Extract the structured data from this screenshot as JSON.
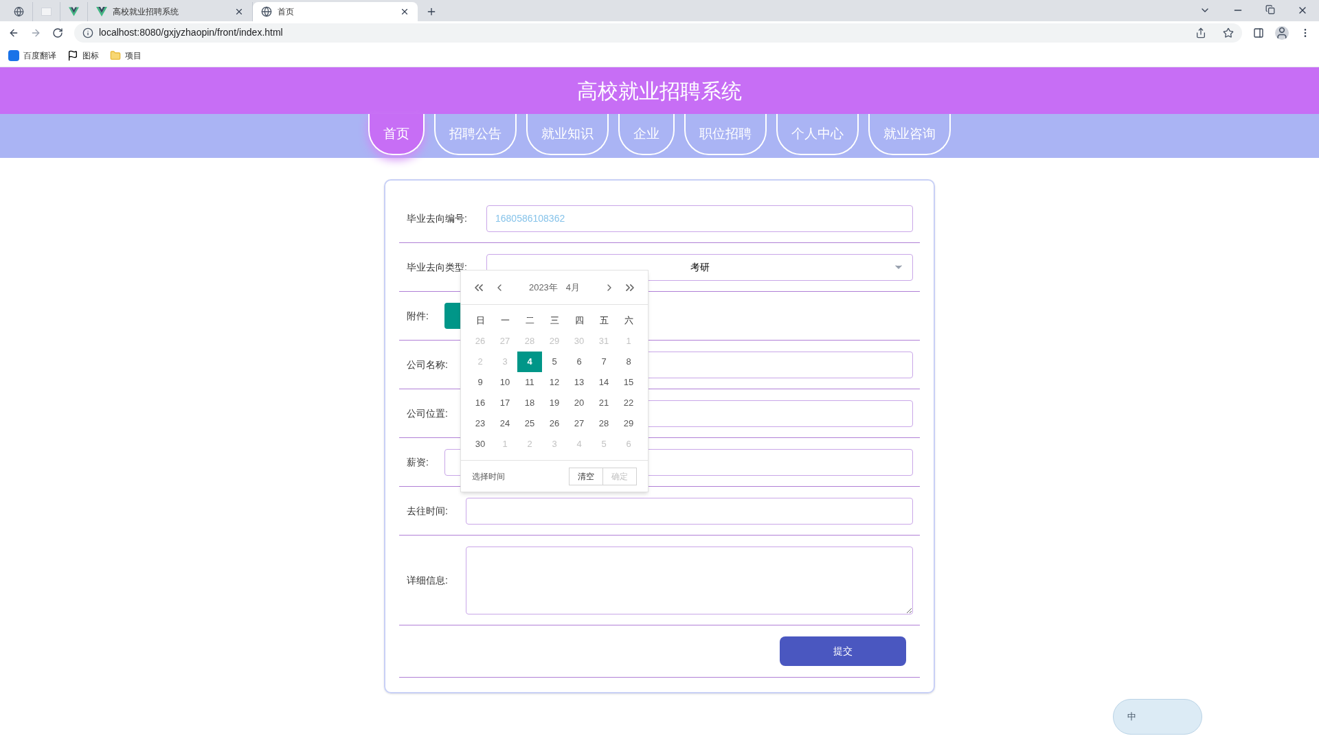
{
  "browser": {
    "tabs": [
      {
        "selected": false
      },
      {
        "selected": false
      },
      {
        "selected": false
      },
      {
        "title": "高校就业招聘系统",
        "selected": false
      },
      {
        "title": "首页",
        "selected": true
      }
    ],
    "url": "localhost:8080/gxjyzhaopin/front/index.html",
    "bookmarks": [
      {
        "label": "百度翻译"
      },
      {
        "label": "图标"
      },
      {
        "label": "项目"
      }
    ]
  },
  "header": {
    "title": "高校就业招聘系统"
  },
  "nav": [
    {
      "label": "首页",
      "selected": true
    },
    {
      "label": "招聘公告",
      "selected": false
    },
    {
      "label": "就业知识",
      "selected": false
    },
    {
      "label": "企业",
      "selected": false
    },
    {
      "label": "职位招聘",
      "selected": false
    },
    {
      "label": "个人中心",
      "selected": false
    },
    {
      "label": "就业咨询",
      "selected": false
    }
  ],
  "form": {
    "rows": [
      {
        "kind": "input",
        "label": "毕业去向编号:",
        "value": "1680586108362",
        "readonly": true
      },
      {
        "kind": "select",
        "label": "毕业去向类型:",
        "value": "考研"
      },
      {
        "kind": "upload",
        "label": "附件:"
      },
      {
        "kind": "input",
        "label": "公司名称:",
        "value": ""
      },
      {
        "kind": "input",
        "label": "公司位置:",
        "value": ""
      },
      {
        "kind": "input",
        "label": "薪资:",
        "value": ""
      },
      {
        "kind": "input",
        "label": "去往时间:",
        "value": ""
      },
      {
        "kind": "textarea",
        "label": "详细信息:",
        "value": ""
      }
    ],
    "submit": "提交"
  },
  "calendar": {
    "year": "2023年",
    "month": "4月",
    "weekdays": [
      "日",
      "一",
      "二",
      "三",
      "四",
      "五",
      "六"
    ],
    "days": [
      {
        "label": "26",
        "muted": true,
        "selected": false
      },
      {
        "label": "27",
        "muted": true,
        "selected": false
      },
      {
        "label": "28",
        "muted": true,
        "selected": false
      },
      {
        "label": "29",
        "muted": true,
        "selected": false
      },
      {
        "label": "30",
        "muted": true,
        "selected": false
      },
      {
        "label": "31",
        "muted": true,
        "selected": false
      },
      {
        "label": "1",
        "muted": true,
        "selected": false
      },
      {
        "label": "2",
        "muted": true,
        "selected": false
      },
      {
        "label": "3",
        "muted": true,
        "selected": false
      },
      {
        "label": "4",
        "muted": false,
        "selected": true
      },
      {
        "label": "5",
        "muted": false,
        "selected": false
      },
      {
        "label": "6",
        "muted": false,
        "selected": false
      },
      {
        "label": "7",
        "muted": false,
        "selected": false
      },
      {
        "label": "8",
        "muted": false,
        "selected": false
      },
      {
        "label": "9",
        "muted": false,
        "selected": false
      },
      {
        "label": "10",
        "muted": false,
        "selected": false
      },
      {
        "label": "11",
        "muted": false,
        "selected": false
      },
      {
        "label": "12",
        "muted": false,
        "selected": false
      },
      {
        "label": "13",
        "muted": false,
        "selected": false
      },
      {
        "label": "14",
        "muted": false,
        "selected": false
      },
      {
        "label": "15",
        "muted": false,
        "selected": false
      },
      {
        "label": "16",
        "muted": false,
        "selected": false
      },
      {
        "label": "17",
        "muted": false,
        "selected": false
      },
      {
        "label": "18",
        "muted": false,
        "selected": false
      },
      {
        "label": "19",
        "muted": false,
        "selected": false
      },
      {
        "label": "20",
        "muted": false,
        "selected": false
      },
      {
        "label": "21",
        "muted": false,
        "selected": false
      },
      {
        "label": "22",
        "muted": false,
        "selected": false
      },
      {
        "label": "23",
        "muted": false,
        "selected": false
      },
      {
        "label": "24",
        "muted": false,
        "selected": false
      },
      {
        "label": "25",
        "muted": false,
        "selected": false
      },
      {
        "label": "26",
        "muted": false,
        "selected": false
      },
      {
        "label": "27",
        "muted": false,
        "selected": false
      },
      {
        "label": "28",
        "muted": false,
        "selected": false
      },
      {
        "label": "29",
        "muted": false,
        "selected": false
      },
      {
        "label": "30",
        "muted": false,
        "selected": false
      },
      {
        "label": "1",
        "muted": true,
        "selected": false
      },
      {
        "label": "2",
        "muted": true,
        "selected": false
      },
      {
        "label": "3",
        "muted": true,
        "selected": false
      },
      {
        "label": "4",
        "muted": true,
        "selected": false
      },
      {
        "label": "5",
        "muted": true,
        "selected": false
      },
      {
        "label": "6",
        "muted": true,
        "selected": false
      }
    ],
    "select_time": "选择时间",
    "clear": "清空",
    "confirm": "确定",
    "confirm_disabled": true
  },
  "ime": {
    "label": "中"
  }
}
